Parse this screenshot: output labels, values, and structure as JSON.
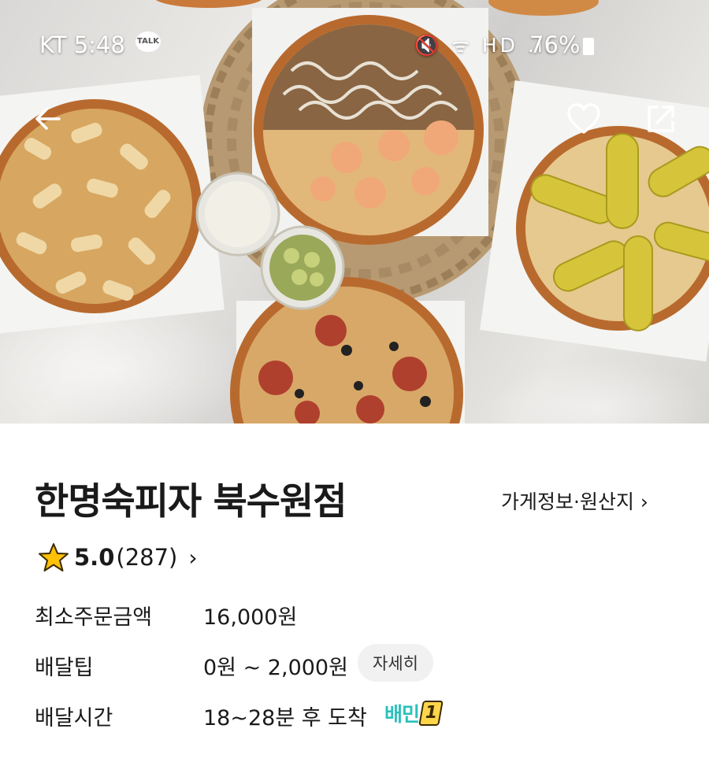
{
  "status_bar": {
    "carrier": "KT",
    "time": "5:48",
    "talk_badge": "TALK",
    "network_icons": "🔇 ᯤ HD .ıl",
    "battery": "76%"
  },
  "store": {
    "name": "한명숙피자 북수원점",
    "info_link": "가게정보·원산지 ›",
    "rating": {
      "score": "5.0",
      "count": "(287)",
      "chevron": "›"
    }
  },
  "info_rows": [
    {
      "label": "최소주문금액",
      "value": "16,000원"
    },
    {
      "label": "배달팁",
      "value": "0원 ~ 2,000원",
      "button": "자세히"
    },
    {
      "label": "배달시간",
      "value": "18~28분 후 도착",
      "badge": "배민",
      "badge_number": "1"
    }
  ],
  "icons": {
    "back": "arrow-left",
    "favorite": "heart-outline",
    "share": "share-box",
    "rating_star": "star",
    "talk": "kakao-talk"
  },
  "colors": {
    "baemin_mint": "#2ac1bc",
    "star_yellow": "#ffc107",
    "pill_bg": "#f1f1f1"
  }
}
